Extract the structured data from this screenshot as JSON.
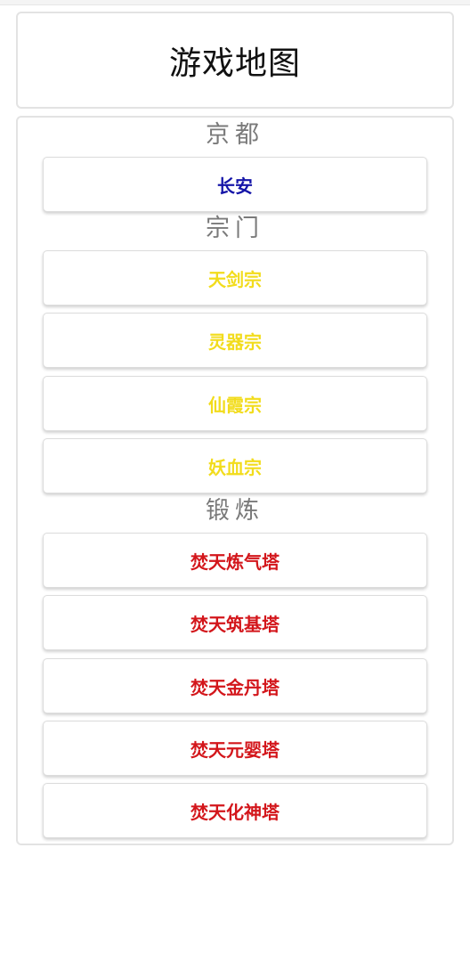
{
  "header": {
    "title": "游戏地图"
  },
  "colors": {
    "capital": "#1515a8",
    "sect": "#f2dc1c",
    "training": "#d3161b",
    "heading": "#7a7a7a"
  },
  "sections": [
    {
      "heading": "京都",
      "items": [
        "长安"
      ]
    },
    {
      "heading": "宗门",
      "items": [
        "天剑宗",
        "灵器宗",
        "仙霞宗",
        "妖血宗"
      ]
    },
    {
      "heading": "锻炼",
      "items": [
        "焚天炼气塔",
        "焚天筑基塔",
        "焚天金丹塔",
        "焚天元婴塔",
        "焚天化神塔"
      ]
    }
  ]
}
